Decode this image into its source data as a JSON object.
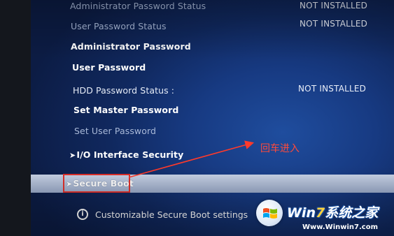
{
  "settings": {
    "admin_status": {
      "label": "Administrator Password Status",
      "value": "NOT INSTALLED"
    },
    "user_status": {
      "label": "User Password Status",
      "value": "NOT INSTALLED"
    },
    "admin_password": {
      "label": "Administrator Password"
    },
    "user_password": {
      "label": "User Password"
    },
    "hdd_status": {
      "label": "HDD Password Status  :",
      "value": "NOT INSTALLED"
    },
    "set_master": {
      "label": "Set Master Password"
    },
    "set_user": {
      "label": "Set User Password"
    },
    "io_security": {
      "label": "I/O Interface Security"
    },
    "secure_boot": {
      "label": "Secure Boot"
    }
  },
  "help": {
    "icon": "info-icon",
    "text": "Customizable Secure Boot settings"
  },
  "annotation": {
    "text": "回车进入",
    "color": "#ff4a3a"
  },
  "watermark": {
    "title_prefix": "Win",
    "title_seven": "7",
    "title_suffix": "系统之家",
    "url": "Www.Winwin7.com"
  },
  "colors": {
    "screen_blue": "#173a82",
    "selection_bar": "#aebbd4",
    "highlight_red": "#e0302a"
  }
}
